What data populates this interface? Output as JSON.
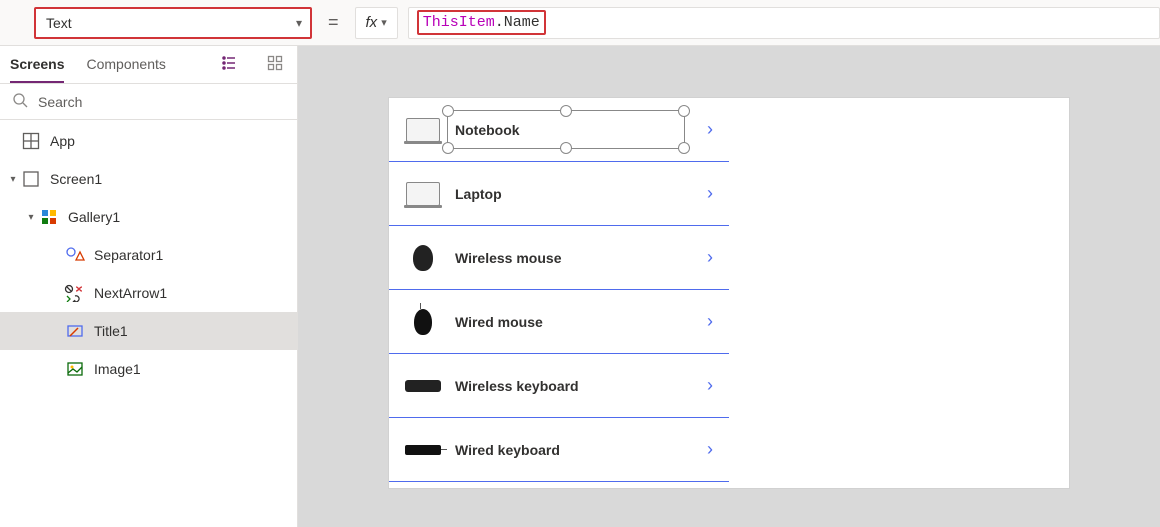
{
  "formula": {
    "property_label": "Text",
    "equals": "=",
    "fx_label": "fx",
    "expr_object": "ThisItem",
    "expr_dot": ".",
    "expr_prop": "Name"
  },
  "tabs": {
    "screens": "Screens",
    "components": "Components"
  },
  "search": {
    "placeholder": "Search"
  },
  "tree": {
    "app": "App",
    "screen1": "Screen1",
    "gallery1": "Gallery1",
    "separator1": "Separator1",
    "nextarrow1": "NextArrow1",
    "title1": "Title1",
    "image1": "Image1"
  },
  "gallery": {
    "items": [
      {
        "label": "Notebook",
        "thumb": "laptop"
      },
      {
        "label": "Laptop",
        "thumb": "laptop"
      },
      {
        "label": "Wireless mouse",
        "thumb": "mouse-wireless"
      },
      {
        "label": "Wired mouse",
        "thumb": "mouse-wired"
      },
      {
        "label": "Wireless keyboard",
        "thumb": "kb-wireless"
      },
      {
        "label": "Wired keyboard",
        "thumb": "kb-wired"
      }
    ]
  }
}
